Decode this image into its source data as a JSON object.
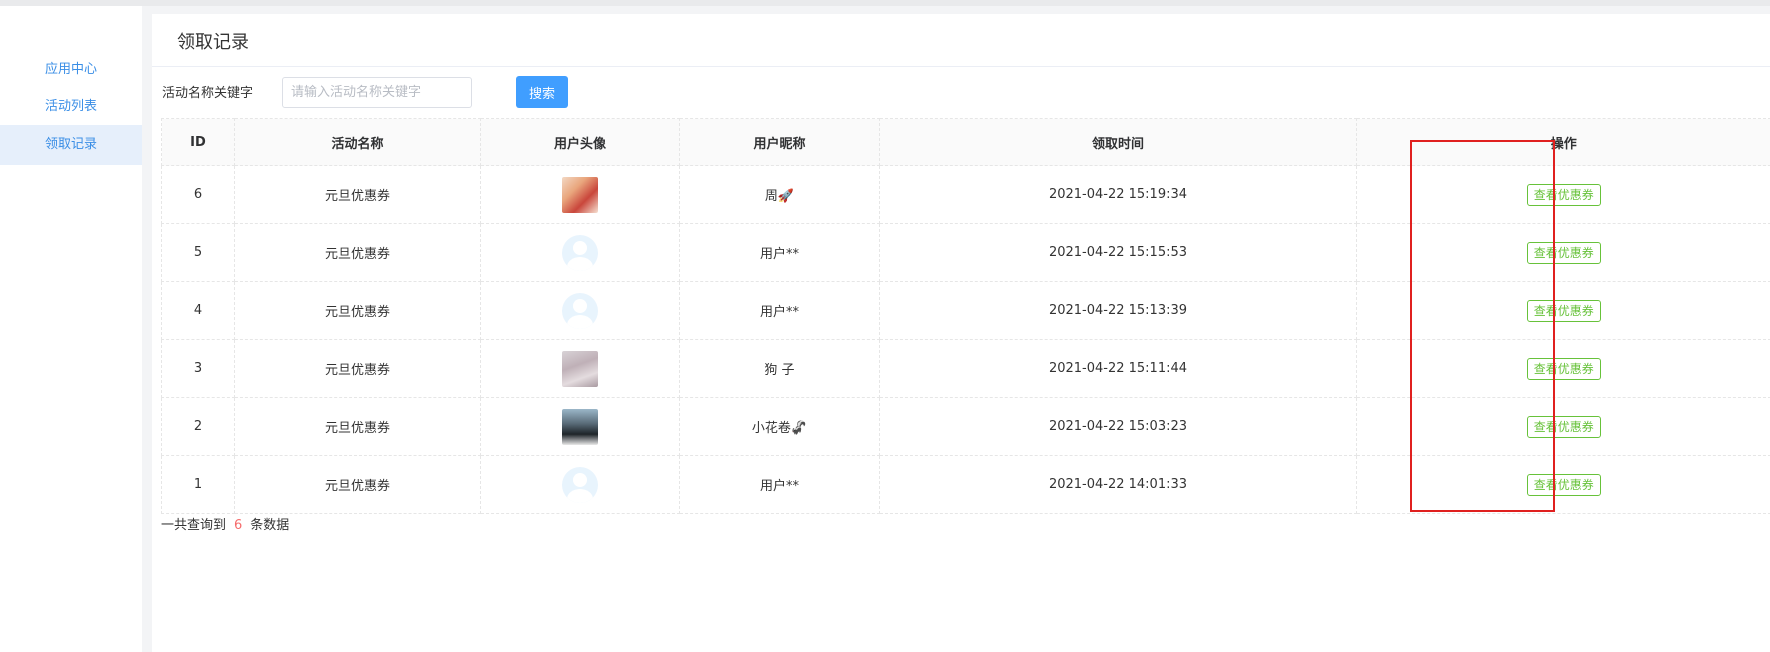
{
  "sidebar": {
    "items": [
      {
        "label": "应用中心",
        "active": false
      },
      {
        "label": "活动列表",
        "active": false
      },
      {
        "label": "领取记录",
        "active": true
      }
    ]
  },
  "page": {
    "title": "领取记录"
  },
  "filter": {
    "label": "活动名称关键字",
    "placeholder": "请输入活动名称关键字",
    "value": "",
    "search_label": "搜索"
  },
  "table": {
    "columns": [
      "ID",
      "活动名称",
      "用户头像",
      "用户昵称",
      "领取时间",
      "操作"
    ],
    "rows": [
      {
        "id": "6",
        "activity": "元旦优惠券",
        "avatar": "photo",
        "nickname": "周🚀",
        "time": "2021-04-22 15:19:34",
        "action": "查看优惠券"
      },
      {
        "id": "5",
        "activity": "元旦优惠券",
        "avatar": "default",
        "nickname": "用户**",
        "time": "2021-04-22 15:15:53",
        "action": "查看优惠券"
      },
      {
        "id": "4",
        "activity": "元旦优惠券",
        "avatar": "default",
        "nickname": "用户**",
        "time": "2021-04-22 15:13:39",
        "action": "查看优惠券"
      },
      {
        "id": "3",
        "activity": "元旦优惠券",
        "avatar": "photo",
        "nickname": "狗 子",
        "time": "2021-04-22 15:11:44",
        "action": "查看优惠券"
      },
      {
        "id": "2",
        "activity": "元旦优惠券",
        "avatar": "photo",
        "nickname": "小花卷🦨",
        "time": "2021-04-22 15:03:23",
        "action": "查看优惠券"
      },
      {
        "id": "1",
        "activity": "元旦优惠券",
        "avatar": "default",
        "nickname": "用户**",
        "time": "2021-04-22 14:01:33",
        "action": "查看优惠券"
      }
    ]
  },
  "footer": {
    "prefix": "一共查询到",
    "count": "6",
    "suffix": "条数据"
  },
  "colors": {
    "accent": "#409eff",
    "success": "#67c23a",
    "count": "#f56c6c",
    "highlight": "#e0201f"
  }
}
